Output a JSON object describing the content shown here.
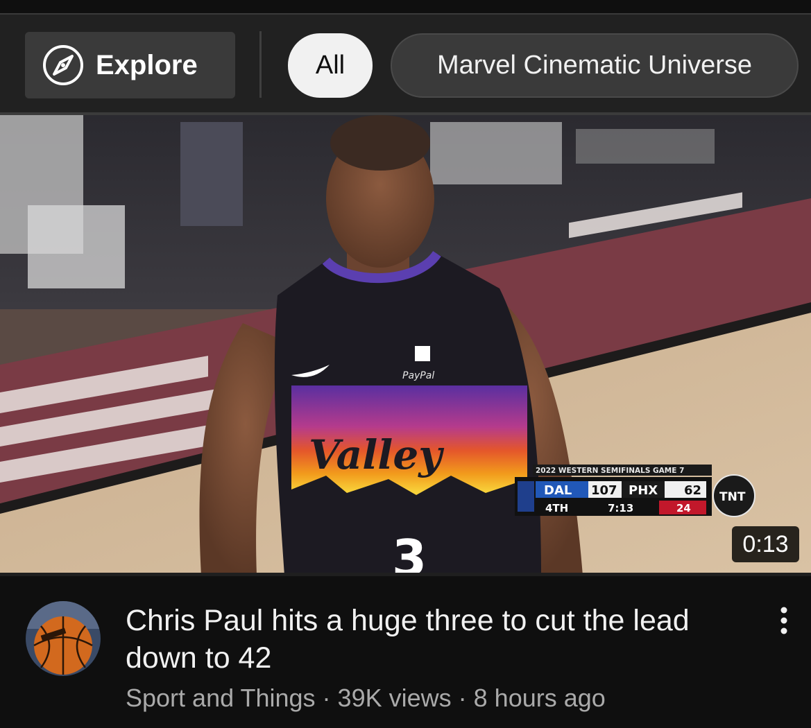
{
  "chips": {
    "explore_label": "Explore",
    "all_label": "All",
    "mcu_label": "Marvel Cinematic Universe"
  },
  "video": {
    "duration": "0:13",
    "title": "Chris Paul hits a huge three to cut the lead down to 42",
    "channel": "Sport and Things",
    "views": "39K views",
    "age": "8 hours ago",
    "separator": "·"
  },
  "scorebug": {
    "headline": "2022 WESTERN SEMIFINALS  GAME 7",
    "team1": "DAL",
    "score1": "107",
    "team2": "PHX",
    "score2": "62",
    "quarter": "4TH",
    "clock": "7:13",
    "shot_clock": "24",
    "network": "TNT"
  },
  "jersey": {
    "wordmark": "Valley",
    "sponsor": "PayPal"
  },
  "colors": {
    "background": "#0f0f0f",
    "chip_bar": "#212121",
    "chip_selected": "#f1f1f1",
    "chip_default": "#3a3a3a",
    "secondary_text": "#aaaaaa"
  }
}
